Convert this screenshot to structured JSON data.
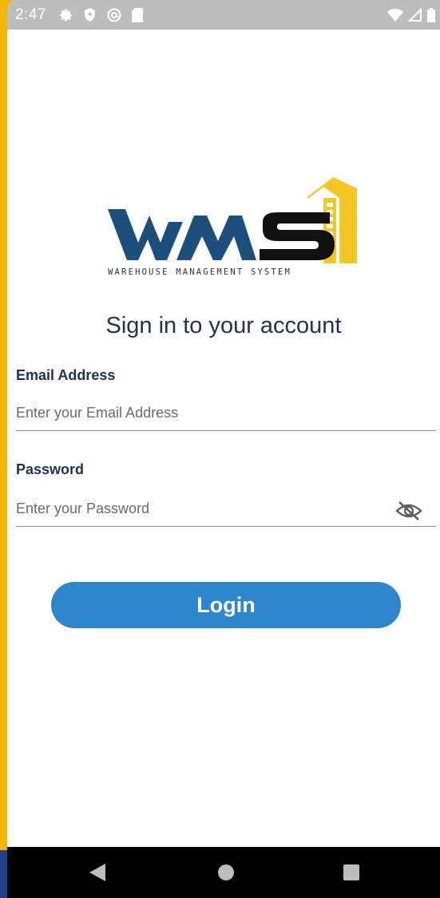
{
  "status_bar": {
    "time": "2:47",
    "left_icons": [
      "settings-icon",
      "shield-icon",
      "at-sign-icon",
      "sd-card-icon"
    ],
    "right_icons": [
      "wifi-icon",
      "signal-icon",
      "battery-icon"
    ]
  },
  "logo": {
    "text": "WMS",
    "subtitle": "WAREHOUSE MANAGEMENT SYSTEM",
    "colors": {
      "blue": "#1c4f7c",
      "black": "#111111",
      "yellow": "#f3c623"
    }
  },
  "heading": "Sign in to your account",
  "email": {
    "label": "Email Address",
    "placeholder": "Enter your Email Address",
    "value": ""
  },
  "password": {
    "label": "Password",
    "placeholder": "Enter your Password",
    "value": "",
    "toggle_icon": "eye-off-icon"
  },
  "login_button": {
    "label": "Login",
    "color": "#2e86cc"
  },
  "nav_bar": {
    "buttons": [
      "back-icon",
      "home-icon",
      "recents-icon"
    ]
  },
  "colors": {
    "frame": "#f2b705",
    "heading": "#1e3350",
    "status_bar": "#bdbdbd"
  }
}
